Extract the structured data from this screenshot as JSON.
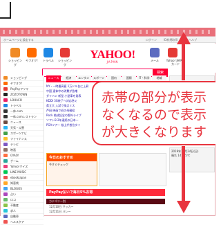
{
  "annotation": {
    "callout_lines": [
      "赤帯の部分が表示",
      "なくなるので表示",
      "が大きくなります"
    ],
    "accent_color": "#e8353f",
    "band_color": "#e9707a"
  },
  "browser": {
    "address_text": "ホームページに設定する",
    "top_links": [
      "ログイン",
      "ID新規取得",
      "ヘルプ"
    ]
  },
  "header": {
    "services": [
      {
        "label": "ショッピング",
        "color": "#f08a24"
      },
      {
        "label": "ヤフオク!",
        "color": "#ff6b00"
      },
      {
        "label": "トラベル",
        "color": "#1e88e5"
      },
      {
        "label": "ショッピング",
        "color": "#e53935"
      }
    ],
    "right_services": [
      {
        "label": "メール",
        "color": "#5c6bc0"
      },
      {
        "label": "Yahoo! JAPANカード",
        "color": "#e53935"
      }
    ],
    "logo": "YAHOO!",
    "logo_sub": "JAPAN",
    "search_button": "検索"
  },
  "sidebar": {
    "items": [
      {
        "label": "ショッピング",
        "color": "#f08a24"
      },
      {
        "label": "ヤフオク!",
        "color": "#ff6b00"
      },
      {
        "label": "PayPayフリマ",
        "color": "#e53935"
      },
      {
        "label": "ZOZOTOWN",
        "color": "#222222"
      },
      {
        "label": "LOHACO",
        "color": "#e91e63"
      },
      {
        "label": "トラベル",
        "color": "#1e88e5"
      },
      {
        "label": "一休.com",
        "color": "#333333"
      },
      {
        "label": "一休.comレストラン",
        "color": "#333333"
      },
      {
        "label": "ニュース",
        "color": "#6d4c41"
      },
      {
        "label": "天気・災害",
        "color": "#29b6f6"
      },
      {
        "label": "スポーツナビ",
        "color": "#43a047"
      },
      {
        "label": "ファイナンス",
        "color": "#fbc02d"
      },
      {
        "label": "テレビ",
        "color": "#7e57c2"
      },
      {
        "label": "映画",
        "color": "#8d6e63"
      },
      {
        "label": "GYAO!",
        "color": "#ff7043"
      },
      {
        "label": "ゲーム",
        "color": "#26a69a"
      },
      {
        "label": "Yahoo!クイズ",
        "color": "#ec407a"
      },
      {
        "label": "LINE MUSIC",
        "color": "#00c853"
      },
      {
        "label": "ebookjapan",
        "color": "#ef5350"
      },
      {
        "label": "知恵袋",
        "color": "#ffa726"
      },
      {
        "label": "BLOGOS",
        "color": "#42a5f5"
      },
      {
        "label": "占い",
        "color": "#ab47bc"
      },
      {
        "label": "ロコ",
        "color": "#66bb6a"
      },
      {
        "label": "不動産",
        "color": "#8bc34a"
      },
      {
        "label": "求人",
        "color": "#26c6da"
      },
      {
        "label": "自動車",
        "color": "#5c6bc0"
      },
      {
        "label": "ヘルスケア",
        "color": "#ef5350"
      }
    ]
  },
  "main": {
    "tabs": [
      "ニュース",
      "経済",
      "エンタメ",
      "スポーツ",
      "国内",
      "国際",
      "IT・科学",
      "地域"
    ],
    "news": [
      "NY・一時最高値 1万ドル台に上昇",
      "中国 連休中の消費が急増",
      "ダイハツ 新型 小型車を発表",
      "KDDI 3G終了へ対応急ぐ",
      "県立大 入試で採点ミス",
      "芦田 映画で初の母親役",
      "Rock 結成記念の野外ライブ",
      "ソフトB 2年連続の日本一",
      "PGAツアー 松山が首位タイ"
    ],
    "promo_title": "今日のおすすめ",
    "promo_text": "今すぐチェック",
    "paypay_text": "PayPay払いで毎日5%お得",
    "calendar_header": "カテゴリー別",
    "calendar_rows": [
      "12月10日 サッカー",
      "12月11日 バレー",
      "12月12日 競泳"
    ]
  },
  "right": {
    "date_text": "2019年11月24日(日)",
    "weather": "晴れ 14℃/5℃"
  }
}
